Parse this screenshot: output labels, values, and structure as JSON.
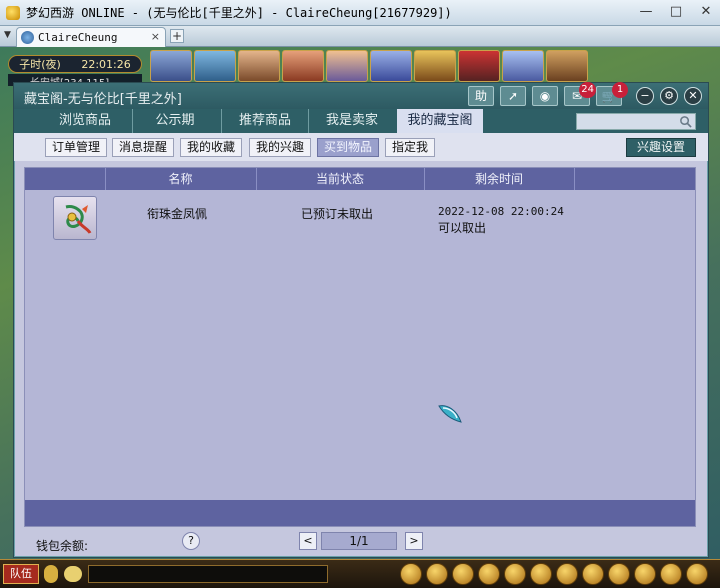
{
  "window": {
    "title": "梦幻西游 ONLINE - (无与伦比[千里之外] - ClaireCheung[21677929])",
    "minimize": "—",
    "maximize": "□",
    "close": "✕"
  },
  "browser": {
    "tab_label": "ClaireCheung",
    "tab_close": "×",
    "new_tab": "+"
  },
  "hud": {
    "time_of_day": "子时(夜)",
    "clock": "22:01:26",
    "city": "长安城[234,115]"
  },
  "panel": {
    "title": "藏宝阁-无与伦比[千里之外]",
    "help_label": "助",
    "messages_count": "24",
    "cart_count": "1",
    "nav_tabs": [
      "浏览商品",
      "公示期",
      "推荐商品",
      "我是卖家",
      "我的藏宝阁"
    ],
    "active_nav": "我的藏宝阁",
    "search_placeholder": ""
  },
  "subnav": {
    "buttons": [
      "订单管理",
      "消息提醒",
      "我的收藏",
      "我的兴趣",
      "买到物品",
      "指定我"
    ],
    "active": "买到物品",
    "interest_settings": "兴趣设置"
  },
  "table": {
    "columns": [
      "名称",
      "当前状态",
      "剩余时间"
    ],
    "rows": [
      {
        "name": "衔珠金凤佩",
        "status": "已预订未取出",
        "time_line1": "2022-12-08 22:00:24",
        "time_line2": "可以取出"
      }
    ]
  },
  "footer": {
    "wallet_label": "钱包余额:",
    "help": "?",
    "prev": "<",
    "page": "1/1",
    "next": ">"
  },
  "bottom_hud": {
    "team_label": "队伍"
  },
  "colors": {
    "panel_bg": "#c5c7de",
    "header_teal": "#2e5f66",
    "table_header": "#5e63a0",
    "badge_red": "#c8203a"
  }
}
